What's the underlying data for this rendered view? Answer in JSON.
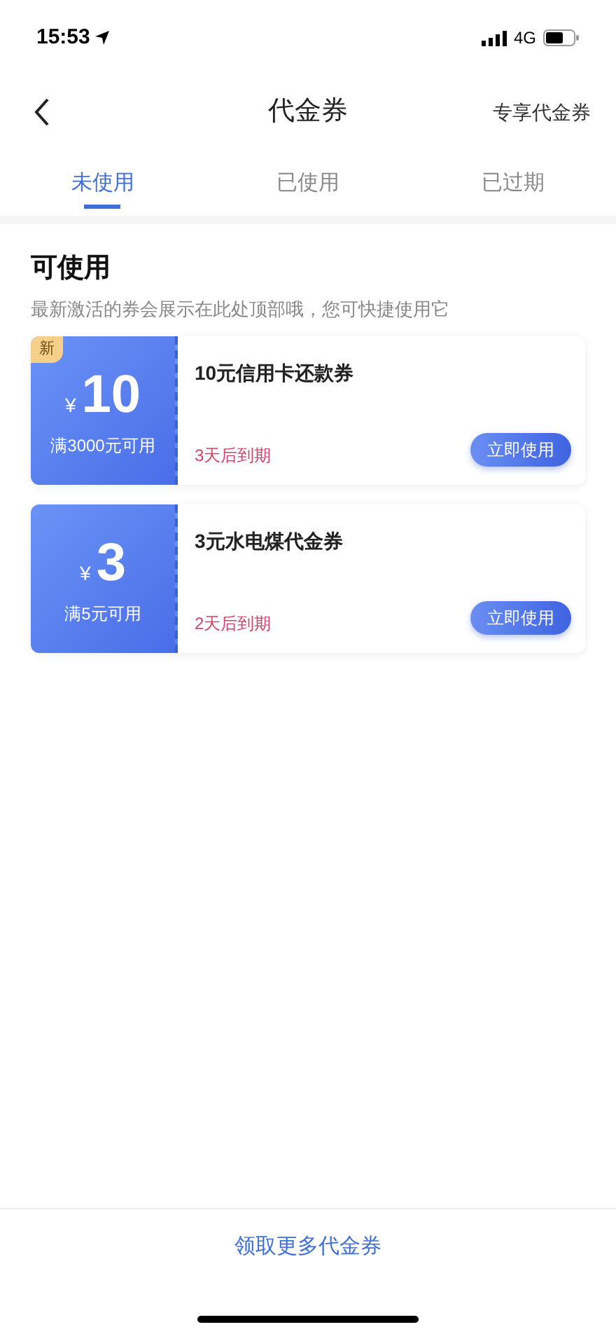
{
  "status_bar": {
    "time": "15:53",
    "network": "4G"
  },
  "nav": {
    "title": "代金券",
    "action": "专享代金券"
  },
  "tabs": [
    {
      "label": "未使用",
      "selected": true
    },
    {
      "label": "已使用",
      "selected": false
    },
    {
      "label": "已过期",
      "selected": false
    }
  ],
  "section": {
    "title": "可使用",
    "subtitle": "最新激活的券会展示在此处顶部哦，您可快捷使用它"
  },
  "coupons": [
    {
      "badge": "新",
      "currency": "¥",
      "amount": "10",
      "condition": "满3000元可用",
      "name": "10元信用卡还款券",
      "expiry": "3天后到期",
      "button": "立即使用"
    },
    {
      "currency": "¥",
      "amount": "3",
      "condition": "满5元可用",
      "name": "3元水电煤代金券",
      "expiry": "2天后到期",
      "button": "立即使用"
    }
  ],
  "footer": {
    "link": "领取更多代金券"
  }
}
